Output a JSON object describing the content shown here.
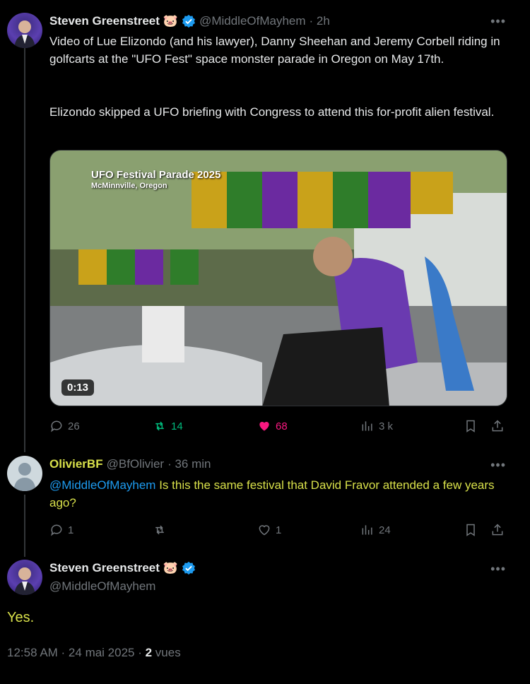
{
  "tweet": {
    "author": "Steven Greenstreet",
    "handle": "@MiddleOfMayhem",
    "time": "· 2h",
    "text_p1": "Video of Lue Elizondo (and his lawyer), Danny Sheehan and Jeremy Corbell riding in golfcarts at the \"UFO Fest\" space monster parade in Oregon on May 17th.",
    "text_p2": "Elizondo skipped a UFO briefing with Congress to attend this for-profit alien festival.",
    "video": {
      "overlay_title": "UFO Festival Parade 2025",
      "overlay_subtitle": "McMinnville, Oregon",
      "duration": "0:13"
    },
    "stats": {
      "replies": "26",
      "reposts": "14",
      "likes": "68",
      "views": "3 k"
    }
  },
  "reply": {
    "author": "OlivierBF",
    "handle": "@BfOlivier",
    "time": "· 36 min",
    "mention": "@MiddleOfMayhem",
    "text": " Is this the same festival that David Fravor attended a few years ago?",
    "stats": {
      "replies": "1",
      "likes": "1",
      "views": "24"
    }
  },
  "focus": {
    "author": "Steven Greenstreet",
    "handle": "@MiddleOfMayhem",
    "text": "Yes.",
    "timestamp": "12:58 AM · 24 mai 2025 · ",
    "views_count": "2",
    "views_label": " vues"
  },
  "colors": {
    "accent_blue": "#1d9bf0",
    "repost_green": "#00ba7c",
    "like_pink": "#f91880",
    "yellow_text": "#d8e04a"
  },
  "icons": [
    "verified-badge",
    "pig-emoji",
    "reply-icon",
    "repost-icon",
    "heart-icon",
    "views-icon",
    "bookmark-icon",
    "share-icon",
    "more-icon"
  ]
}
